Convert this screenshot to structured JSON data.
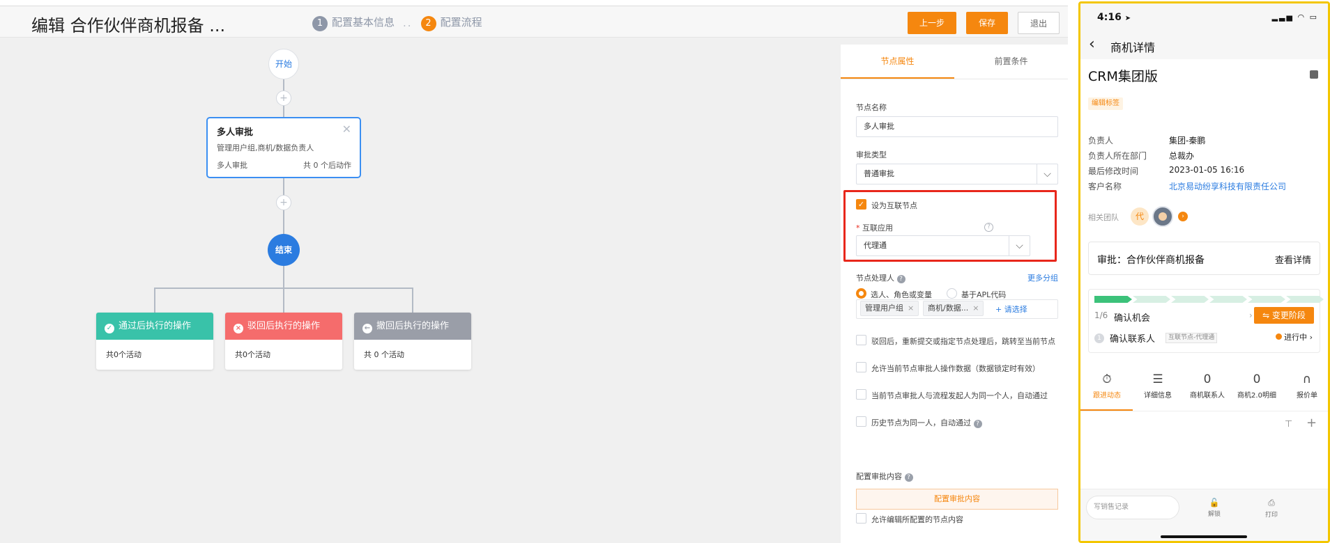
{
  "editor": {
    "title": "编辑 合作伙伴商机报备 ...",
    "steps": [
      {
        "num": "1",
        "label": "配置基本信息"
      },
      {
        "num": "2",
        "label": "配置流程"
      }
    ],
    "step_separator": "..",
    "buttons": {
      "prev": "上一步",
      "save": "保存",
      "exit": "退出"
    }
  },
  "flow": {
    "start": "开始",
    "plus": "+",
    "approval_node": {
      "title": "多人审批",
      "subtitle": "管理用户组,商机/数据负责人",
      "type": "多人审批",
      "count": "共 0 个后动作"
    },
    "end": "结束",
    "actions": [
      {
        "label": "通过后执行的操作",
        "count": "共0个活动",
        "icon": "✓"
      },
      {
        "label": "驳回后执行的操作",
        "count": "共0个活动",
        "icon": "×"
      },
      {
        "label": "撤回后执行的操作",
        "count": "共 0 个活动",
        "icon": "←"
      }
    ]
  },
  "properties": {
    "tabs": [
      "节点属性",
      "前置条件"
    ],
    "node_name_label": "节点名称",
    "node_name_value": "多人审批",
    "approval_type_label": "审批类型",
    "approval_type_value": "普通审批",
    "interconnect_checkbox": "设为互联节点",
    "interconnect_app_label": "互联应用",
    "interconnect_app_value": "代理通",
    "handler_label": "节点处理人",
    "more_groups": "更多分组",
    "radio_select": "选人、角色或变量",
    "radio_apl": "基于APL代码",
    "tags": [
      "管理用户组",
      "商机/数据..."
    ],
    "add_select": "+ 请选择",
    "options": [
      "驳回后，重新提交或指定节点处理后，跳转至当前节点",
      "允许当前节点审批人操作数据（数据锁定时有效）",
      "当前节点审批人与流程发起人为同一个人，自动通过",
      "历史节点为同一人，自动通过"
    ],
    "config_content_label": "配置审批内容",
    "config_content_button": "配置审批内容",
    "allow_edit": "允许编辑所配置的节点内容"
  },
  "mobile": {
    "time": "4:16",
    "nav_title": "商机详情",
    "title": "CRM集团版",
    "tag": "编辑标签",
    "fields": [
      {
        "label": "负责人",
        "value": "集团-秦鹏"
      },
      {
        "label": "负责人所在部门",
        "value": "总裁办"
      },
      {
        "label": "最后修改时间",
        "value": "2023-01-05 16:16"
      },
      {
        "label": "客户名称",
        "value": "北京易动纷享科技有限责任公司"
      }
    ],
    "team_label": "相关团队",
    "team_avatar_text": "代",
    "approval_title": "审批：合作伙伴商机报备",
    "approval_link": "查看详情",
    "stage_count": "1/6",
    "stage_name": "确认机会",
    "stage_button": "⇋ 变更阶段",
    "step_num": "1",
    "step_name": "确认联系人",
    "step_tag": "互联节点-代理通",
    "step_status": "进行中",
    "tabs": [
      {
        "icon": "⏱",
        "label": "跟进动态"
      },
      {
        "icon": "☰",
        "label": "详细信息"
      },
      {
        "icon": "0",
        "label": "商机联系人"
      },
      {
        "icon": "0",
        "label": "商机2.0明细"
      },
      {
        "icon": "∩",
        "label": "报价单"
      }
    ],
    "input_placeholder": "写销售记录",
    "actions": [
      {
        "icon": "🔓",
        "label": "解锁"
      },
      {
        "icon": "⎙",
        "label": "打印"
      }
    ]
  },
  "colors": {
    "accent": "#f5870f",
    "blue": "#2b7ce0",
    "pass": "#39c2a9",
    "reject": "#f56c6c",
    "withdraw": "#9a9ea8",
    "highlight_box": "#e8271b",
    "phone_frame": "#f3c600"
  }
}
